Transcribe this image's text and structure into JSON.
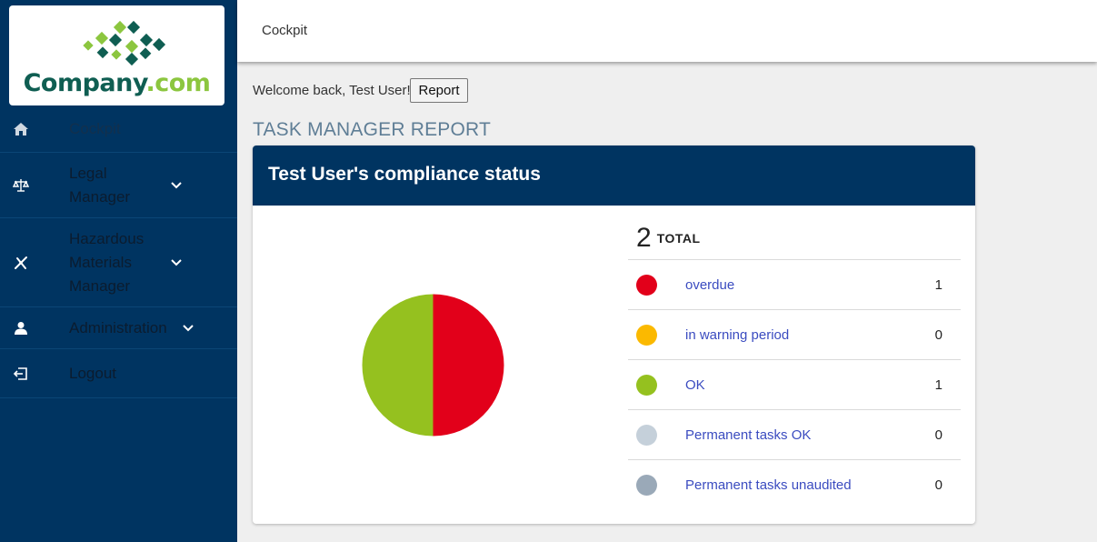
{
  "brand": {
    "name": "Company",
    "tld": ".com",
    "colors": {
      "dark": "#0f5e52",
      "light": "#8cc63f"
    }
  },
  "sidebar": {
    "items": [
      {
        "icon": "home-icon",
        "label": "Cockpit",
        "active": true,
        "expandable": false
      },
      {
        "icon": "scales-icon",
        "label": "Legal Manager",
        "expandable": true
      },
      {
        "icon": "hazard-icon",
        "label": "Hazardous Materials Manager",
        "expandable": true
      },
      {
        "icon": "admin-user-icon",
        "label": "Administration",
        "expandable": true
      },
      {
        "icon": "logout-icon",
        "label": "Logout",
        "expandable": false
      }
    ]
  },
  "header": {
    "breadcrumb": "Cockpit"
  },
  "main": {
    "welcome": "Welcome back, Test User!",
    "report_button": "Report",
    "section_title": "TASK MANAGER REPORT",
    "card": {
      "title": "Test User's compliance status",
      "total_value": "2",
      "total_label": "TOTAL",
      "statuses": [
        {
          "label": "overdue",
          "value": 1,
          "color": "#e2001a"
        },
        {
          "label": "in warning period",
          "value": 0,
          "color": "#fbb900"
        },
        {
          "label": "OK",
          "value": 1,
          "color": "#95c11f"
        },
        {
          "label": "Permanent tasks OK",
          "value": 0,
          "color": "#c5d0da"
        },
        {
          "label": "Permanent tasks unaudited",
          "value": 0,
          "color": "#9aa9b8"
        }
      ]
    }
  },
  "chart_data": {
    "type": "pie",
    "categories": [
      "overdue",
      "in warning period",
      "OK",
      "Permanent tasks OK",
      "Permanent tasks unaudited"
    ],
    "values": [
      1,
      0,
      1,
      0,
      0
    ],
    "colors": [
      "#e2001a",
      "#fbb900",
      "#95c11f",
      "#c5d0da",
      "#9aa9b8"
    ]
  }
}
